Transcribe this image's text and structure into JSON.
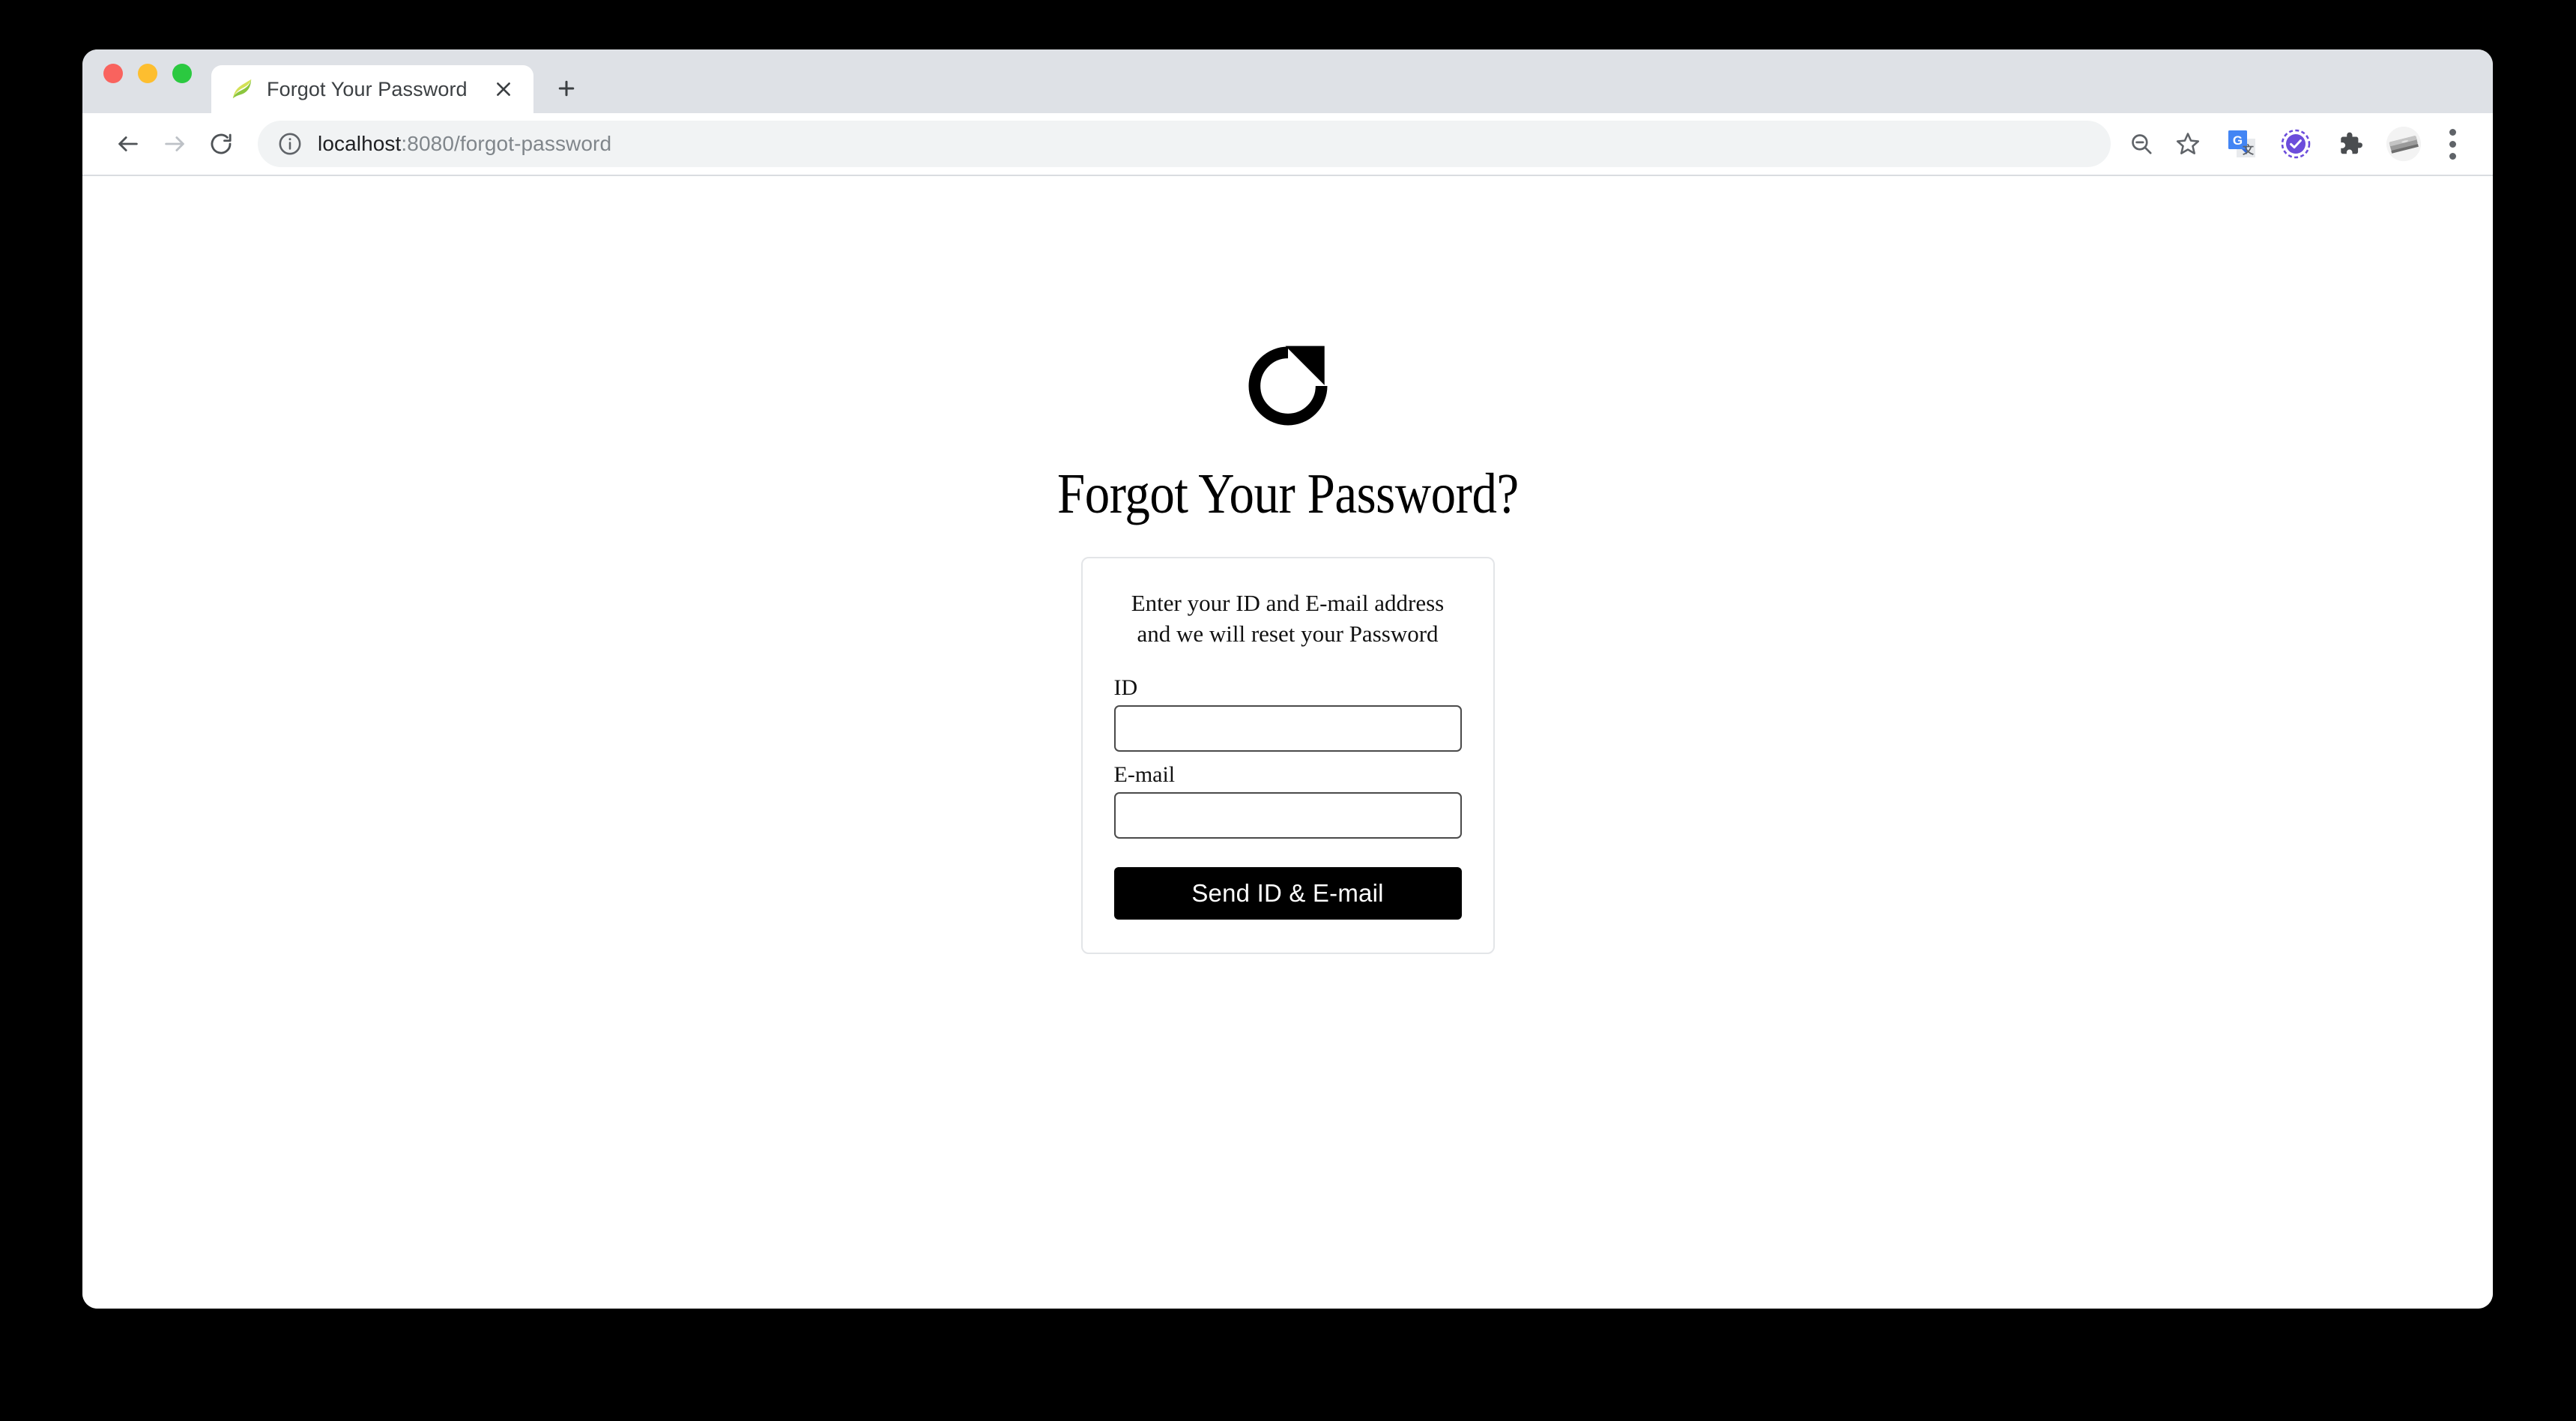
{
  "window": {
    "traffic_lights": {
      "close_color": "#f9635e",
      "minimize_color": "#fdbe2f",
      "maximize_color": "#2bc940"
    }
  },
  "tab_strip": {
    "tabs": [
      {
        "title": "Forgot Your Password",
        "favicon": "spring-leaf-icon",
        "close_label": "×",
        "active": true
      }
    ],
    "new_tab_label": "+"
  },
  "toolbar": {
    "back_icon": "back-arrow-icon",
    "forward_icon": "forward-arrow-icon",
    "reload_icon": "reload-icon",
    "site_info_icon": "info-circle-icon",
    "url": {
      "host": "localhost",
      "rest": ":8080/forgot-password",
      "full": "localhost:8080/forgot-password"
    },
    "actions": [
      {
        "name": "zoom-out-icon",
        "label": "Zoom out"
      },
      {
        "name": "bookmark-star-icon",
        "label": "Bookmark this tab"
      },
      {
        "name": "google-translate-icon",
        "label": "Translate this page"
      },
      {
        "name": "purple-check-badge-icon",
        "label": "Extension"
      },
      {
        "name": "puzzle-piece-icon",
        "label": "Extensions"
      },
      {
        "name": "profile-avatar",
        "label": "Profile"
      }
    ],
    "menu_icon": "three-dot-menu-icon"
  },
  "page": {
    "hero_icon": "circular-arrow-reset-icon",
    "title": "Forgot Your Password?",
    "card": {
      "lead_line_1": "Enter your ID and E-mail address",
      "lead_line_2": "and we will reset your Password",
      "fields": [
        {
          "label": "ID",
          "value": "",
          "placeholder": "",
          "type": "text"
        },
        {
          "label": "E-mail",
          "value": "",
          "placeholder": "",
          "type": "text"
        }
      ],
      "submit_label": "Send ID & E-mail"
    }
  },
  "colors": {
    "accent": "#000000",
    "tab_strip_bg": "#dee1e6",
    "omnibox_bg": "#f1f3f4",
    "card_border": "#e3e5e8",
    "input_border": "#4a4a4a",
    "desktop_bg": "#000000"
  }
}
